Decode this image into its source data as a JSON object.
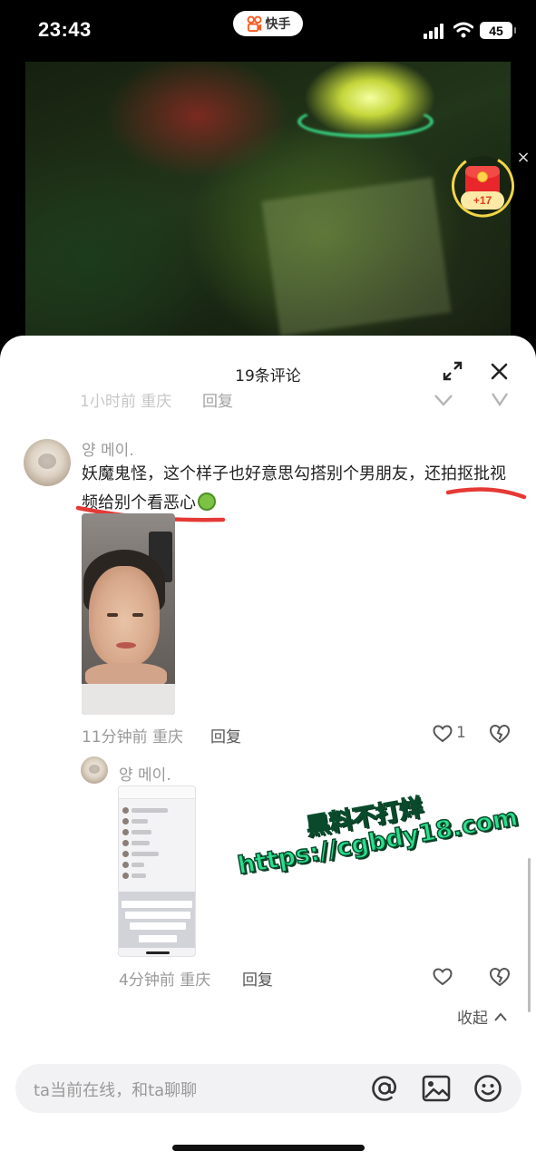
{
  "status_bar": {
    "time": "23:43",
    "app_name": "快手",
    "battery": "45",
    "icons": [
      "signal-icon",
      "wifi-icon",
      "battery-icon"
    ]
  },
  "video": {
    "reward_badge": "+17",
    "icons": [
      "red-packet-icon",
      "close-icon"
    ]
  },
  "comments_panel": {
    "count_title": "19条评论",
    "previous_comment": {
      "time": "1小时前 重庆",
      "reply_label": "回复"
    },
    "main_comment": {
      "username": "양 메이.",
      "text": "妖魔鬼怪，这个样子也好意思勾搭别个男朋友，还拍抠批视频给别个看恶心",
      "emoji": "nauseated-face-emoji",
      "meta": "11分钟前 重庆",
      "reply_label": "回复",
      "like_count": "1"
    },
    "reply_comment": {
      "username": "양 메이.",
      "meta": "4分钟前 重庆",
      "reply_label": "回复"
    },
    "collapse_label": "收起",
    "annotation_color": "#e53935"
  },
  "watermark": {
    "line1": "黑料不打烊",
    "line2": "https://cgbdy18.com",
    "color": "#28e08d"
  },
  "input_bar": {
    "placeholder": "ta当前在线，和ta聊聊",
    "icons": [
      "at-icon",
      "image-icon",
      "emoji-icon"
    ]
  }
}
